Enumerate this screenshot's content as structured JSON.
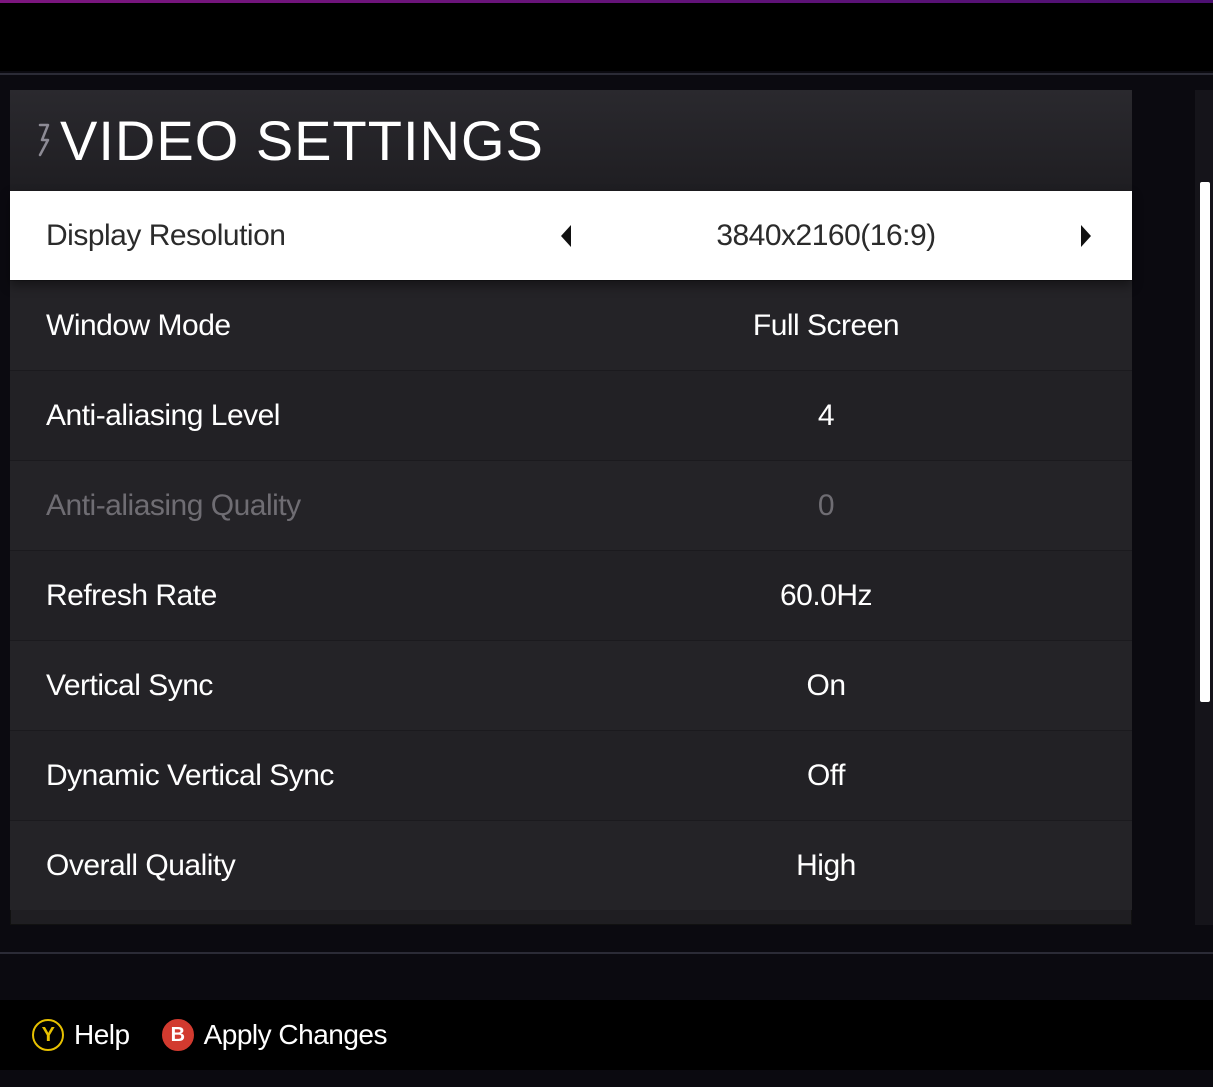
{
  "header": {
    "title": "VIDEO SETTINGS"
  },
  "rows": [
    {
      "label": "Display Resolution",
      "value": "3840x2160(16:9)",
      "selected": true
    },
    {
      "label": "Window Mode",
      "value": "Full Screen"
    },
    {
      "label": "Anti-aliasing Level",
      "value": "4"
    },
    {
      "label": "Anti-aliasing Quality",
      "value": "0",
      "disabled": true
    },
    {
      "label": "Refresh Rate",
      "value": "60.0Hz"
    },
    {
      "label": "Vertical Sync",
      "value": "On"
    },
    {
      "label": "Dynamic Vertical Sync",
      "value": "Off"
    },
    {
      "label": "Overall Quality",
      "value": "High"
    }
  ],
  "footer": {
    "help_key": "Y",
    "help_label": "Help",
    "apply_key": "B",
    "apply_label": "Apply Changes"
  }
}
